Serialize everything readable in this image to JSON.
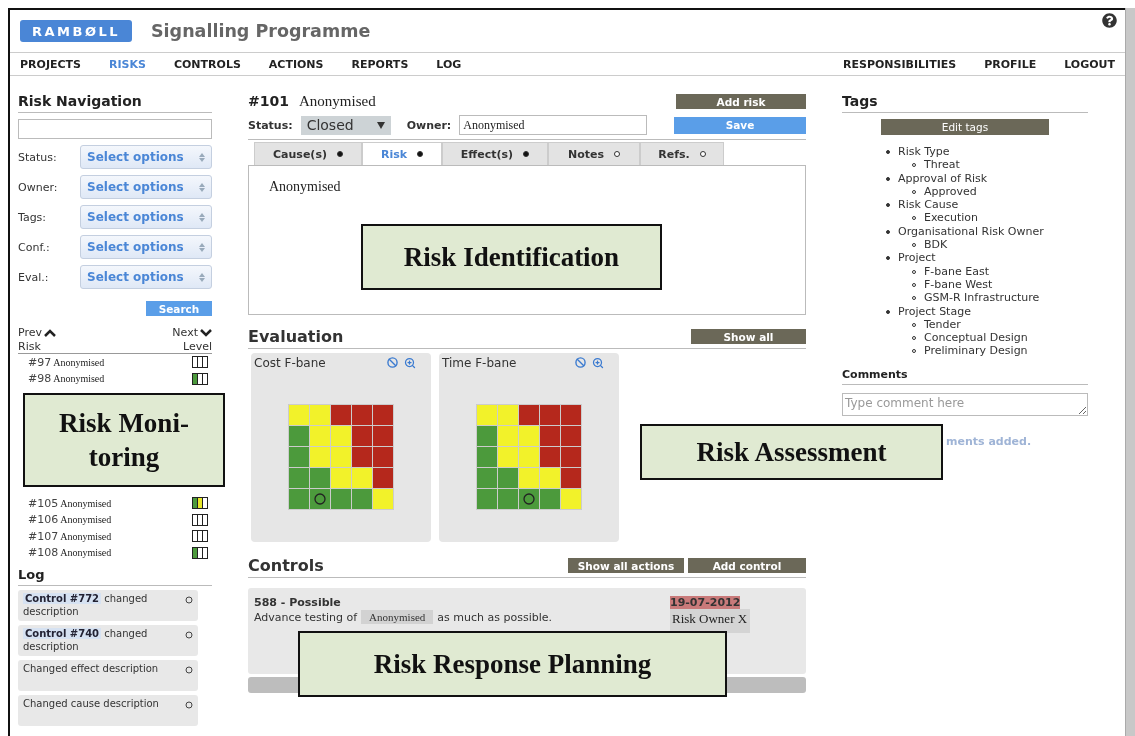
{
  "header": {
    "logo": "RAMBØLL",
    "title": "Signalling Programme"
  },
  "menu_left": [
    {
      "label": "PROJECTS",
      "selected": false
    },
    {
      "label": "RISKS",
      "selected": true
    },
    {
      "label": "CONTROLS",
      "selected": false
    },
    {
      "label": "ACTIONS",
      "selected": false
    },
    {
      "label": "REPORTS",
      "selected": false
    },
    {
      "label": "LOG",
      "selected": false
    }
  ],
  "menu_right": [
    {
      "label": "RESPONSIBILITIES",
      "selected": false
    },
    {
      "label": "PROFILE",
      "selected": false
    },
    {
      "label": "LOGOUT",
      "selected": false
    }
  ],
  "navigation": {
    "title": "Risk Navigation",
    "filters": [
      {
        "label": "Status:",
        "value": "Select options"
      },
      {
        "label": "Owner:",
        "value": "Select options"
      },
      {
        "label": "Tags:",
        "value": "Select options"
      },
      {
        "label": "Conf.:",
        "value": "Select options"
      },
      {
        "label": "Eval.:",
        "value": "Select options"
      }
    ],
    "search_button": "Search",
    "prev": "Prev",
    "next": "Next",
    "columns": [
      "Risk",
      "Level"
    ],
    "risks": [
      {
        "id": "#97",
        "name": "Anonymised",
        "bars": [
          {
            "color": "#ffffff"
          },
          {
            "color": "#ffffff"
          },
          {
            "color": "#ffffff"
          }
        ]
      },
      {
        "id": "#98",
        "name": "Anonymised",
        "bars": [
          {
            "color": "#4c9a3c"
          },
          {
            "color": "#ffffff"
          },
          {
            "color": "#ffffff"
          }
        ]
      },
      {
        "id": "#105",
        "name": "Anonymised",
        "bars": [
          {
            "color": "#4c9a3c"
          },
          {
            "color": "#e8e82a"
          },
          {
            "color": "#ffffff"
          }
        ]
      },
      {
        "id": "#106",
        "name": "Anonymised",
        "bars": [
          {
            "color": "#ffffff"
          },
          {
            "color": "#ffffff"
          },
          {
            "color": "#ffffff"
          }
        ]
      },
      {
        "id": "#107",
        "name": "Anonymised",
        "bars": [
          {
            "color": "#ffffff"
          },
          {
            "color": "#ffffff"
          },
          {
            "color": "#ffffff"
          }
        ]
      },
      {
        "id": "#108",
        "name": "Anonymised",
        "bars": [
          {
            "color": "#4c9a3c"
          },
          {
            "color": "#ffffff"
          },
          {
            "color": "#ffffff"
          }
        ]
      }
    ]
  },
  "log": {
    "title": "Log",
    "entries": [
      {
        "link": "Control #772",
        "text": "changed description"
      },
      {
        "link": "Control #740",
        "text": "changed description"
      },
      {
        "text": "Changed effect description"
      },
      {
        "text": "Changed cause description"
      }
    ]
  },
  "risk": {
    "number": "#101",
    "name": "Anonymised",
    "add_button": "Add risk",
    "status_label": "Status:",
    "status": "Closed",
    "owner_label": "Owner:",
    "owner": "Anonymised",
    "save_button": "Save",
    "tabs": [
      {
        "label": "Cause(s)",
        "selected": false,
        "filled": true
      },
      {
        "label": "Risk",
        "selected": true,
        "filled": true
      },
      {
        "label": "Effect(s)",
        "selected": false,
        "filled": true
      },
      {
        "label": "Notes",
        "selected": false,
        "filled": false
      },
      {
        "label": "Refs.",
        "selected": false,
        "filled": false
      }
    ],
    "text": "Anonymised"
  },
  "evaluation": {
    "title": "Evaluation",
    "show_all": "Show all",
    "matrices": [
      {
        "title": "Cost F-bane",
        "rows": [
          [
            {
              "color": "#f2f22a",
              "marked": false
            },
            {
              "color": "#f2f22a",
              "marked": false
            },
            {
              "color": "#b5281c",
              "marked": false
            },
            {
              "color": "#b5281c",
              "marked": false
            },
            {
              "color": "#b5281c",
              "marked": false
            }
          ],
          [
            {
              "color": "#4c9a3c",
              "marked": false
            },
            {
              "color": "#f2f22a",
              "marked": false
            },
            {
              "color": "#f2f22a",
              "marked": false
            },
            {
              "color": "#b5281c",
              "marked": false
            },
            {
              "color": "#b5281c",
              "marked": false
            }
          ],
          [
            {
              "color": "#4c9a3c",
              "marked": false
            },
            {
              "color": "#f2f22a",
              "marked": false
            },
            {
              "color": "#f2f22a",
              "marked": false
            },
            {
              "color": "#b5281c",
              "marked": false
            },
            {
              "color": "#b5281c",
              "marked": false
            }
          ],
          [
            {
              "color": "#4c9a3c",
              "marked": false
            },
            {
              "color": "#4c9a3c",
              "marked": false
            },
            {
              "color": "#f2f22a",
              "marked": false
            },
            {
              "color": "#f2f22a",
              "marked": false
            },
            {
              "color": "#b5281c",
              "marked": false
            }
          ],
          [
            {
              "color": "#4c9a3c",
              "marked": false
            },
            {
              "color": "#4c9a3c",
              "marked": true
            },
            {
              "color": "#4c9a3c",
              "marked": false
            },
            {
              "color": "#4c9a3c",
              "marked": false
            },
            {
              "color": "#f2f22a",
              "marked": false
            }
          ]
        ]
      },
      {
        "title": "Time F-bane",
        "rows": [
          [
            {
              "color": "#f2f22a",
              "marked": false
            },
            {
              "color": "#f2f22a",
              "marked": false
            },
            {
              "color": "#b5281c",
              "marked": false
            },
            {
              "color": "#b5281c",
              "marked": false
            },
            {
              "color": "#b5281c",
              "marked": false
            }
          ],
          [
            {
              "color": "#4c9a3c",
              "marked": false
            },
            {
              "color": "#f2f22a",
              "marked": false
            },
            {
              "color": "#f2f22a",
              "marked": false
            },
            {
              "color": "#b5281c",
              "marked": false
            },
            {
              "color": "#b5281c",
              "marked": false
            }
          ],
          [
            {
              "color": "#4c9a3c",
              "marked": false
            },
            {
              "color": "#f2f22a",
              "marked": false
            },
            {
              "color": "#f2f22a",
              "marked": false
            },
            {
              "color": "#b5281c",
              "marked": false
            },
            {
              "color": "#b5281c",
              "marked": false
            }
          ],
          [
            {
              "color": "#4c9a3c",
              "marked": false
            },
            {
              "color": "#4c9a3c",
              "marked": false
            },
            {
              "color": "#f2f22a",
              "marked": false
            },
            {
              "color": "#f2f22a",
              "marked": false
            },
            {
              "color": "#b5281c",
              "marked": false
            }
          ],
          [
            {
              "color": "#4c9a3c",
              "marked": false
            },
            {
              "color": "#4c9a3c",
              "marked": false
            },
            {
              "color": "#4c9a3c",
              "marked": true
            },
            {
              "color": "#4c9a3c",
              "marked": false
            },
            {
              "color": "#f2f22a",
              "marked": false
            }
          ]
        ]
      }
    ]
  },
  "controls": {
    "title": "Controls",
    "buttons": [
      "Show all actions",
      "Add control"
    ],
    "items": [
      {
        "title": "588 - Possible",
        "before": "Advance testing of",
        "tag": "Anonymised",
        "after": "as much as possible.",
        "date": "19-07-2012",
        "owner": "Risk Owner X"
      }
    ]
  },
  "tags": {
    "title": "Tags",
    "edit_button": "Edit tags",
    "groups": [
      {
        "label": "Risk Type",
        "children": [
          {
            "label": "Threat"
          }
        ]
      },
      {
        "label": "Approval of Risk",
        "children": [
          {
            "label": "Approved"
          }
        ]
      },
      {
        "label": "Risk Cause",
        "children": [
          {
            "label": "Execution"
          }
        ]
      },
      {
        "label": "Organisational Risk Owner",
        "children": [
          {
            "label": "BDK"
          }
        ]
      },
      {
        "label": "Project",
        "children": [
          {
            "label": "F-bane East"
          },
          {
            "label": "F-bane West"
          },
          {
            "label": "GSM-R Infrastructure"
          }
        ]
      },
      {
        "label": "Project Stage",
        "children": [
          {
            "label": "Tender"
          },
          {
            "label": "Conceptual Design"
          },
          {
            "label": "Preliminary Design"
          }
        ]
      }
    ]
  },
  "comments": {
    "title": "Comments",
    "placeholder": "Type comment here",
    "note": "ments added."
  },
  "callouts": [
    {
      "lines": [
        "Risk Identification"
      ]
    },
    {
      "lines": [
        "Risk Moni-",
        "toring"
      ]
    },
    {
      "lines": [
        "Risk Assessment"
      ]
    },
    {
      "lines": [
        "Risk Response Planning"
      ]
    }
  ]
}
